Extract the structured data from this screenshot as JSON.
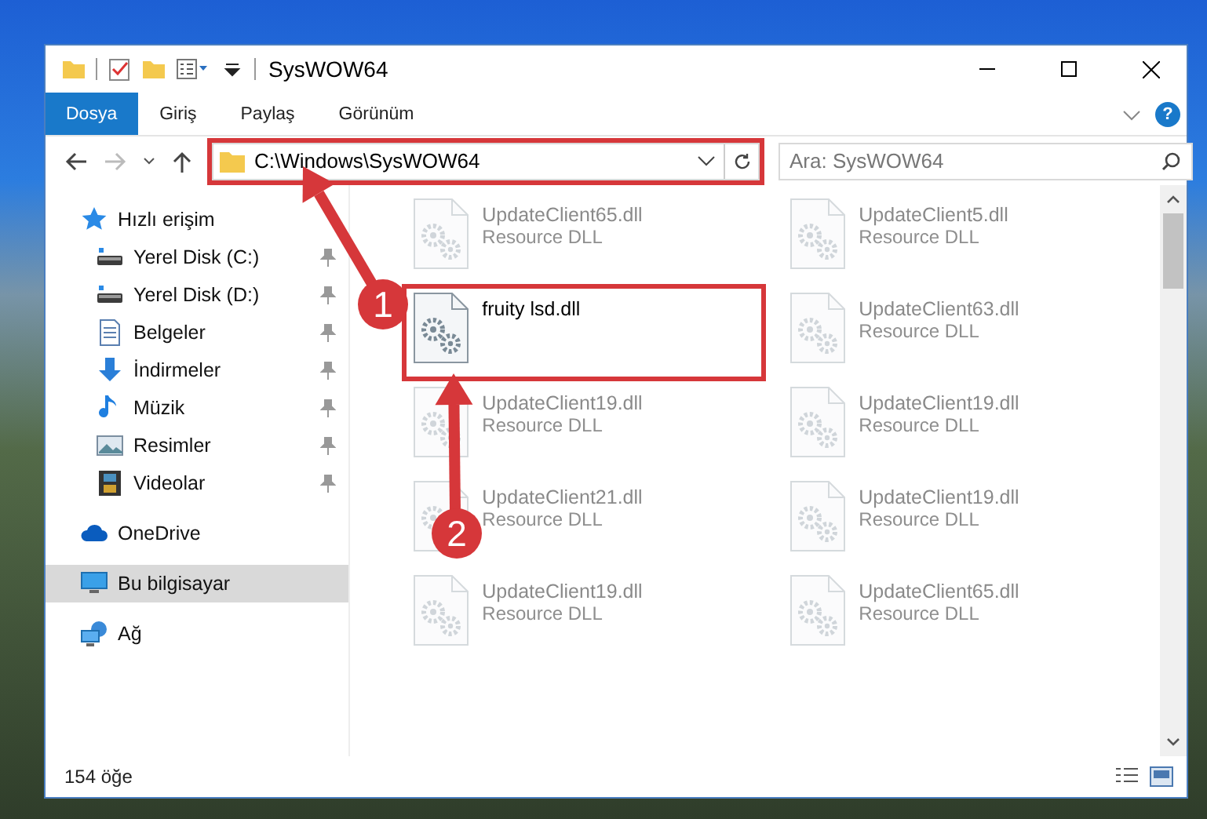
{
  "window": {
    "title": "SysWOW64"
  },
  "ribbon": {
    "tabs": [
      {
        "label": "Dosya",
        "selected": true
      },
      {
        "label": "Giriş",
        "selected": false
      },
      {
        "label": "Paylaş",
        "selected": false
      },
      {
        "label": "Görünüm",
        "selected": false
      }
    ],
    "help": "?"
  },
  "address_bar": {
    "value": "C:\\Windows\\SysWOW64",
    "highlighted": true
  },
  "search": {
    "placeholder": "Ara: SysWOW64"
  },
  "sidebar": {
    "items": [
      {
        "label": "Hızlı erişim",
        "kind": "star",
        "selected": false,
        "children": [
          {
            "label": "Yerel Disk (C:)",
            "kind": "drive",
            "selected": false,
            "pinned": true
          },
          {
            "label": "Yerel Disk (D:)",
            "kind": "drive",
            "selected": false,
            "pinned": true
          },
          {
            "label": "Belgeler",
            "kind": "document",
            "selected": false,
            "pinned": true
          },
          {
            "label": "İndirmeler",
            "kind": "download",
            "selected": false,
            "pinned": true
          },
          {
            "label": "Müzik",
            "kind": "music",
            "selected": false,
            "pinned": true
          },
          {
            "label": "Resimler",
            "kind": "pictures",
            "selected": false,
            "pinned": true
          },
          {
            "label": "Videolar",
            "kind": "video",
            "selected": false,
            "pinned": true
          }
        ]
      },
      {
        "label": "OneDrive",
        "kind": "cloud",
        "selected": false
      },
      {
        "label": "Bu bilgisayar",
        "kind": "computer",
        "selected": true
      },
      {
        "label": "Ağ",
        "kind": "network",
        "selected": false
      }
    ]
  },
  "files": [
    {
      "name": "UpdateClient65.dll",
      "type": "Resource DLL",
      "dimmed": true,
      "highlighted": false
    },
    {
      "name": "UpdateClient5.dll",
      "type": "Resource DLL",
      "dimmed": true,
      "highlighted": false
    },
    {
      "name": "fruity lsd.dll",
      "dimmed": false,
      "highlighted": true
    },
    {
      "name": "UpdateClient63.dll",
      "type": "Resource DLL",
      "dimmed": true,
      "highlighted": false
    },
    {
      "name": "UpdateClient19.dll",
      "type": "Resource DLL",
      "dimmed": true,
      "highlighted": false
    },
    {
      "name": "UpdateClient19.dll",
      "type": "Resource DLL",
      "dimmed": true,
      "highlighted": false
    },
    {
      "name": "UpdateClient21.dll",
      "type": "Resource DLL",
      "dimmed": true,
      "highlighted": false
    },
    {
      "name": "UpdateClient19.dll",
      "type": "Resource DLL",
      "dimmed": true,
      "highlighted": false
    },
    {
      "name": "UpdateClient19.dll",
      "type": "Resource DLL",
      "dimmed": true,
      "highlighted": false
    },
    {
      "name": "UpdateClient65.dll",
      "type": "Resource DLL",
      "dimmed": true,
      "highlighted": false
    }
  ],
  "status_bar": {
    "count": "154 öğe"
  },
  "annotations": [
    {
      "number": "1"
    },
    {
      "number": "2"
    }
  ]
}
